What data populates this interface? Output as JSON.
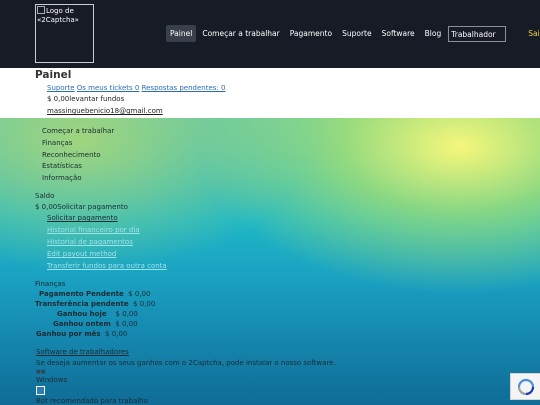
{
  "header": {
    "logo_alt": "Logo de «2Captcha»",
    "nav": [
      "Painel",
      "Começar a trabalhar",
      "Pagamento",
      "Suporte",
      "Software",
      "Blog"
    ],
    "role_select": "Trabalhador",
    "exit": "Sair"
  },
  "page": {
    "title": "Painel",
    "support_label": "Suporte",
    "my_tickets": "Os meus tickets 0",
    "pending_answers": "Respostas pendentes: 0",
    "balance": "$ 0,00",
    "withdraw": "levantar fundos",
    "email": "massinguebenicio18@gmail.com"
  },
  "menu": [
    "Começar a trabalhar",
    "Finanças",
    "Reconhecimento",
    "Estatísticas",
    "Informação"
  ],
  "saldo": {
    "heading": "Saldo",
    "amount": "$ 0,00",
    "request": "Solicitar pagamento",
    "links": [
      "Solicitar pagamento",
      "Historial financeiro por dia",
      "Historial de pagamentos",
      "Edit payout method",
      "Transferir fundos para outra conta"
    ]
  },
  "finance": {
    "heading": "Finanças",
    "rows": [
      {
        "label": "Pagamento Pendente",
        "value": "$ 0,00"
      },
      {
        "label": "Transferência pendente",
        "value": "$ 0,00"
      },
      {
        "label": "Ganhou hoje",
        "value": "$ 0,00"
      },
      {
        "label": "Ganhou ontem",
        "value": "$ 0,00"
      },
      {
        "label": "Ganhou por mês",
        "value": "$ 0,00"
      }
    ]
  },
  "software": {
    "link": "Software de trabalhadores",
    "desc": "Se deseja aumentar os seus ganhos com o 2Captcha, pode instalar o nosso software.",
    "os": "Windows",
    "bot": "Bot recomendado para trabalho"
  }
}
